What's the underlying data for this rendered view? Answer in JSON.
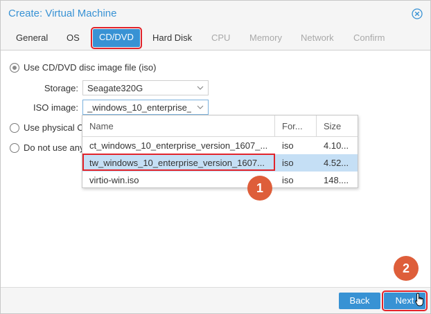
{
  "window": {
    "title": "Create: Virtual Machine",
    "close_icon": "close-circle-icon"
  },
  "tabs": [
    {
      "label": "General",
      "state": "normal"
    },
    {
      "label": "OS",
      "state": "normal"
    },
    {
      "label": "CD/DVD",
      "state": "active"
    },
    {
      "label": "Hard Disk",
      "state": "normal"
    },
    {
      "label": "CPU",
      "state": "disabled"
    },
    {
      "label": "Memory",
      "state": "disabled"
    },
    {
      "label": "Network",
      "state": "disabled"
    },
    {
      "label": "Confirm",
      "state": "disabled"
    }
  ],
  "options": {
    "iso_option": {
      "label": "Use CD/DVD disc image file (iso)",
      "checked": true
    },
    "physical_option": {
      "label": "Use physical C",
      "checked": false
    },
    "none_option": {
      "label": "Do not use any",
      "checked": false
    }
  },
  "fields": {
    "storage": {
      "label": "Storage:",
      "value": "Seagate320G"
    },
    "iso_image": {
      "label": "ISO image:",
      "value": "_windows_10_enterprise_"
    }
  },
  "dropdown": {
    "columns": [
      "Name",
      "For...",
      "Size"
    ],
    "rows": [
      {
        "name": "ct_windows_10_enterprise_version_1607_...",
        "format": "iso",
        "size": "4.10...",
        "selected": false
      },
      {
        "name": "tw_windows_10_enterprise_version_1607...",
        "format": "iso",
        "size": "4.52...",
        "selected": true
      },
      {
        "name": "virtio-win.iso",
        "format": "iso",
        "size": "148....",
        "selected": false
      }
    ]
  },
  "annotations": {
    "step1": "1",
    "step2": "2"
  },
  "footer": {
    "back_label": "Back",
    "next_label": "Next"
  },
  "colors": {
    "accent": "#3892d4",
    "highlight": "#e2232a",
    "badge": "#de5e3a",
    "selected_row": "#c5dff5"
  }
}
